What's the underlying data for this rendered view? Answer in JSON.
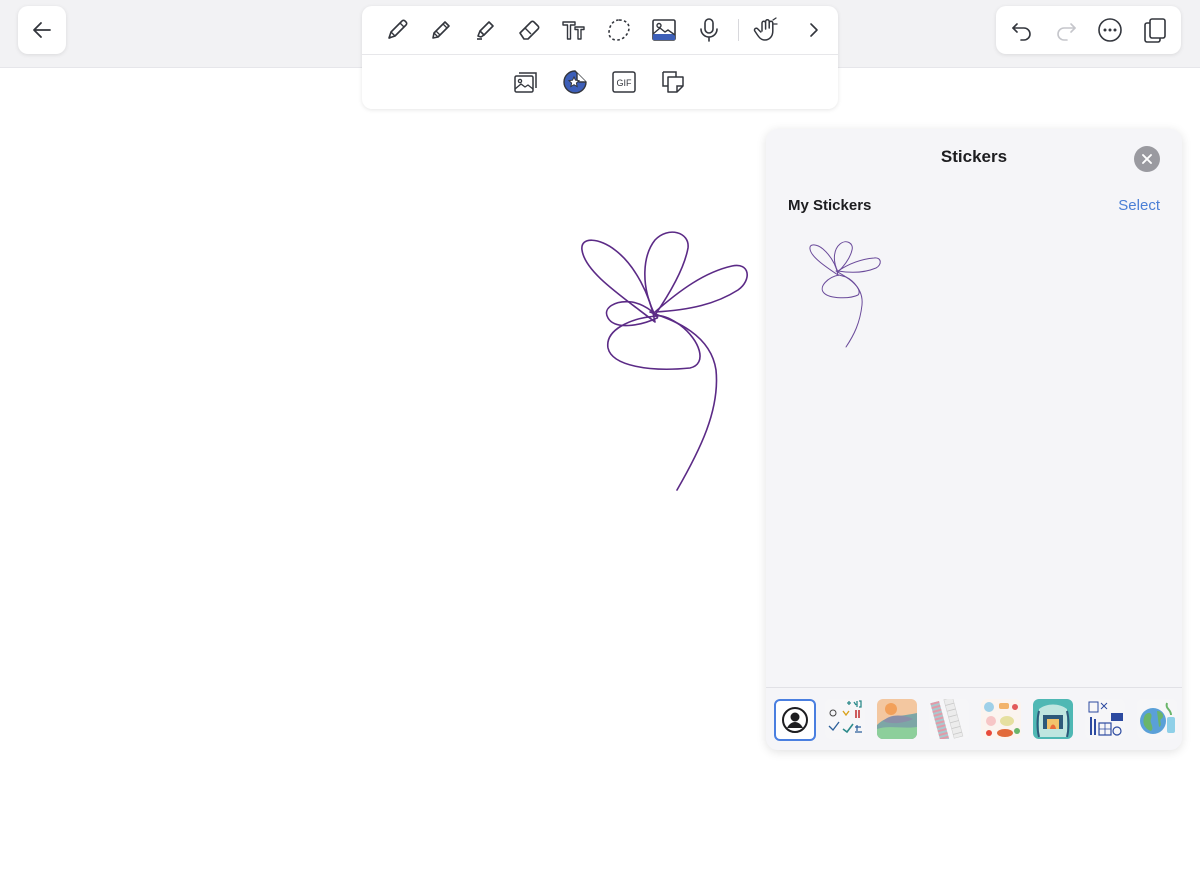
{
  "panel": {
    "title": "Stickers",
    "section_title": "My Stickers",
    "select_label": "Select"
  },
  "toolbar": {
    "primary_tools": [
      "pen-icon",
      "pencil-icon",
      "highlighter-icon",
      "eraser-icon",
      "text-icon",
      "lasso-icon",
      "image-icon",
      "microphone-icon",
      "touch-hand-icon",
      "chevron-right-icon"
    ],
    "secondary_tools": [
      "photo-library-icon",
      "sticker-icon",
      "gif-icon",
      "sticky-note-icon"
    ],
    "gif_label": "GIF"
  },
  "colors": {
    "ink": "#5b2a86",
    "accent": "#4a7fd6",
    "selected_tool": "#3d5fb8"
  },
  "sticker_packs": [
    "my-stickers-pack",
    "math-doodles-pack",
    "landscape-pack",
    "washi-tape-pack",
    "food-pack",
    "scene-pack",
    "school-pack",
    "earth-pack"
  ]
}
